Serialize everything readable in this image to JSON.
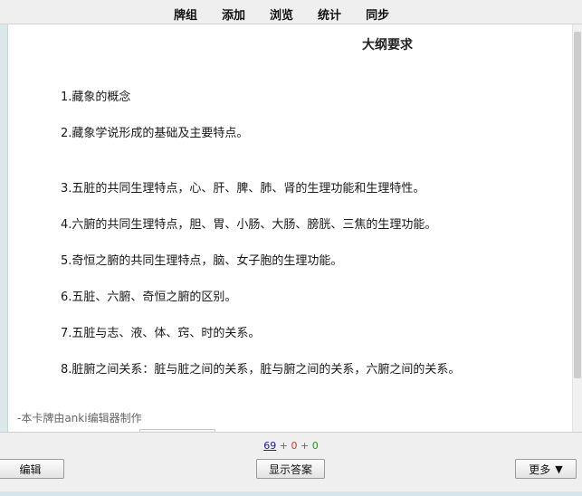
{
  "nav": {
    "items": [
      "牌组",
      "添加",
      "浏览",
      "统计",
      "同步"
    ]
  },
  "card": {
    "title": "大纲要求",
    "lines": [
      "1.藏象的概念",
      "2.藏象学说形成的基础及主要特点。",
      "3.五脏的共同生理特点，心、肝、脾、肺、肾的生理功能和生理特性。",
      "4.六腑的共同生理特点，胆、胃、小肠、大肠、膀胱、三焦的生理功能。",
      "5.奇恒之腑的共同生理特点，脑、女子胞的生理功能。",
      "6.五脏、六腑、奇恒之腑的区别。",
      "7.五脏与志、液、体、窍、时的关系。",
      "8.脏腑之间关系：脏与脏之间的关系，脏与腑之间的关系，六腑之间的关系。"
    ],
    "footer_note": "-本卡牌由anki编辑器制作"
  },
  "counts": {
    "new": "69",
    "sep1": " + ",
    "learn": "0",
    "sep2": " + ",
    "review": "0"
  },
  "buttons": {
    "edit": "编辑",
    "show_answer": "显示答案",
    "more": "更多",
    "more_arrow": "▼"
  },
  "colors": {
    "new_count": "#1a1ab4",
    "learn_count": "#c0392b",
    "review_count": "#2e8b2e"
  }
}
